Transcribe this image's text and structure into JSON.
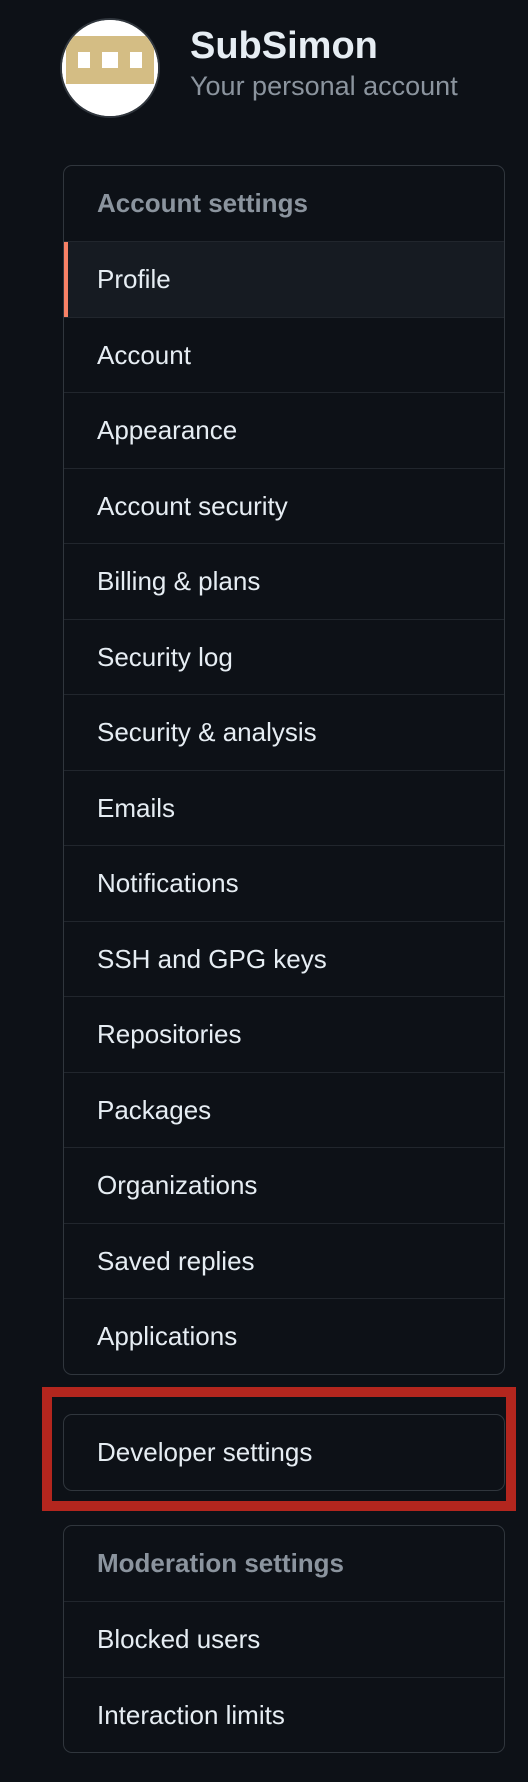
{
  "user": {
    "name": "SubSimon",
    "subtitle": "Your personal account"
  },
  "account_settings": {
    "header": "Account settings",
    "items": [
      {
        "label": "Profile",
        "selected": true
      },
      {
        "label": "Account"
      },
      {
        "label": "Appearance"
      },
      {
        "label": "Account security"
      },
      {
        "label": "Billing & plans"
      },
      {
        "label": "Security log"
      },
      {
        "label": "Security & analysis"
      },
      {
        "label": "Emails"
      },
      {
        "label": "Notifications"
      },
      {
        "label": "SSH and GPG keys"
      },
      {
        "label": "Repositories"
      },
      {
        "label": "Packages"
      },
      {
        "label": "Organizations"
      },
      {
        "label": "Saved replies"
      },
      {
        "label": "Applications"
      }
    ]
  },
  "developer_settings": {
    "label": "Developer settings"
  },
  "moderation_settings": {
    "header": "Moderation settings",
    "items": [
      {
        "label": "Blocked users"
      },
      {
        "label": "Interaction limits"
      }
    ]
  },
  "colors": {
    "background": "#0d1117",
    "border": "#30363d",
    "selected_accent": "#f78166",
    "highlight_annotation": "#b3261e",
    "avatar_pattern": "#d4bd84"
  }
}
